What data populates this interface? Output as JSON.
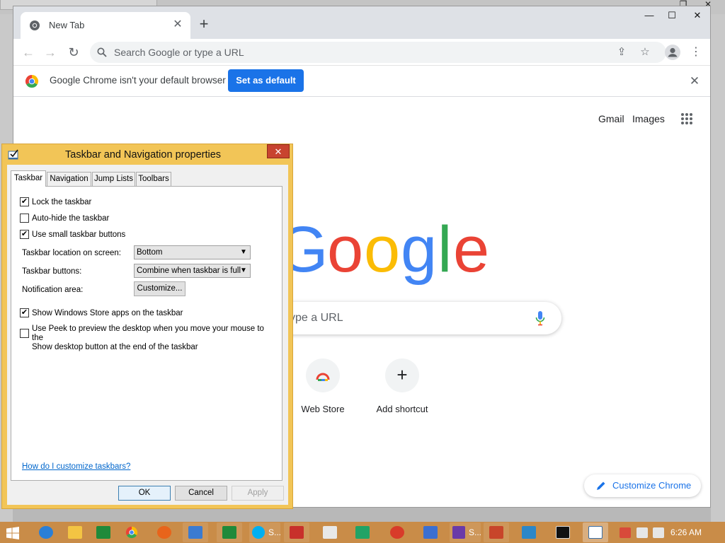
{
  "chrome": {
    "tab_title": "New Tab",
    "omnibox_placeholder": "Search Google or type a URL",
    "infobar_text": "Google Chrome isn't your default browser",
    "set_default_label": "Set as default",
    "gmail_link": "Gmail",
    "images_link": "Images",
    "search_placeholder_visible": "ype a URL",
    "shortcuts": [
      {
        "label": "Web Store"
      },
      {
        "label": "Add shortcut"
      }
    ],
    "customize_label": "Customize Chrome",
    "colors": {
      "accent": "#1a73e8"
    }
  },
  "dialog": {
    "title": "Taskbar and Navigation properties",
    "tabs": [
      {
        "label": "Taskbar"
      },
      {
        "label": "Navigation"
      },
      {
        "label": "Jump Lists"
      },
      {
        "label": "Toolbars"
      }
    ],
    "checkboxes": {
      "lock": {
        "label": "Lock the taskbar",
        "checked": true
      },
      "autohide": {
        "label": "Auto-hide the taskbar",
        "checked": false
      },
      "small": {
        "label": "Use small taskbar buttons",
        "checked": true
      },
      "store_apps": {
        "label": "Show Windows Store apps on the taskbar",
        "checked": true
      },
      "peek_line1": "Use Peek to preview the desktop when you move your mouse to the",
      "peek_line2": "Show desktop button at the end of the taskbar",
      "peek_checked": false
    },
    "location_label": "Taskbar location on screen:",
    "location_value": "Bottom",
    "buttons_label": "Taskbar buttons:",
    "buttons_value": "Combine when taskbar is full",
    "notification_label": "Notification area:",
    "customize_btn": "Customize...",
    "help_link": "How do I customize taskbars?",
    "ok": "OK",
    "cancel": "Cancel",
    "apply": "Apply",
    "colors": {
      "title_bar": "#f2c557",
      "close": "#c8442f"
    }
  },
  "taskbar": {
    "skype_label": "S...",
    "trophy_label": "S...",
    "clock": "6:26 AM",
    "colors": {
      "bar": "#c98c48"
    }
  }
}
